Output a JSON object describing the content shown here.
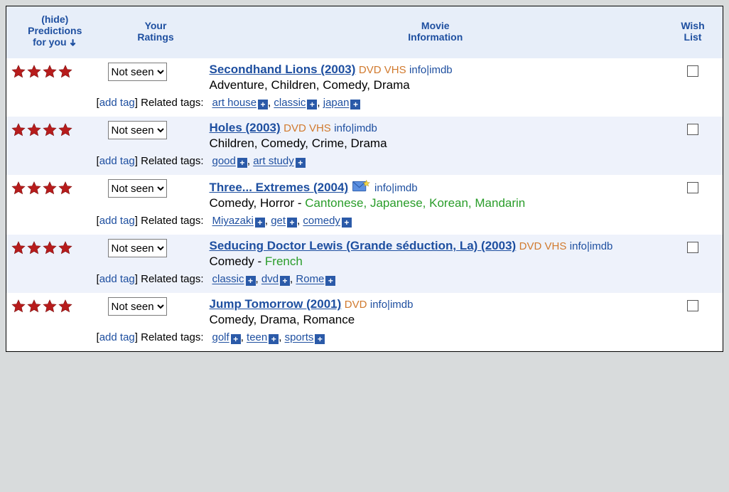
{
  "header": {
    "hide_label": "(hide)",
    "predictions_line": "Predictions",
    "predictions_for_you": "for you",
    "your_ratings_line1": "Your",
    "your_ratings_line2": "Ratings",
    "movie_line1": "Movie",
    "movie_line2": "Information",
    "wish_line1": "Wish",
    "wish_line2": "List"
  },
  "common": {
    "not_seen": "Not seen",
    "info": "info",
    "imdb": "imdb",
    "add_tag": "add tag",
    "related_tags": "Related tags:"
  },
  "movies": [
    {
      "stars": 4.0,
      "title": "Secondhand Lions (2003)",
      "formats": "DVD VHS",
      "genres": "Adventure, Children, Comedy, Drama",
      "languages": "",
      "mail": false,
      "tags": [
        "art house",
        "classic",
        "japan"
      ]
    },
    {
      "stars": 4.0,
      "title": "Holes (2003)",
      "formats": "DVD VHS",
      "genres": "Children, Comedy, Crime, Drama",
      "languages": "",
      "mail": false,
      "tags": [
        "good",
        "art study"
      ]
    },
    {
      "stars": 3.5,
      "title": "Three... Extremes (2004)",
      "formats": "",
      "genres": "Comedy, Horror",
      "languages": "Cantonese, Japanese, Korean, Mandarin",
      "mail": true,
      "tags": [
        "Miyazaki",
        "get",
        "comedy"
      ]
    },
    {
      "stars": 3.5,
      "title": "Seducing Doctor Lewis (Grande séduction, La) (2003)",
      "formats": "DVD VHS",
      "genres": "Comedy",
      "languages": "French",
      "mail": false,
      "tags": [
        "classic",
        "dvd",
        "Rome"
      ]
    },
    {
      "stars": 3.5,
      "title": "Jump Tomorrow (2001)",
      "formats": "DVD",
      "genres": "Comedy, Drama, Romance",
      "languages": "",
      "mail": false,
      "tags": [
        "golf",
        "teen",
        "sports"
      ]
    }
  ]
}
